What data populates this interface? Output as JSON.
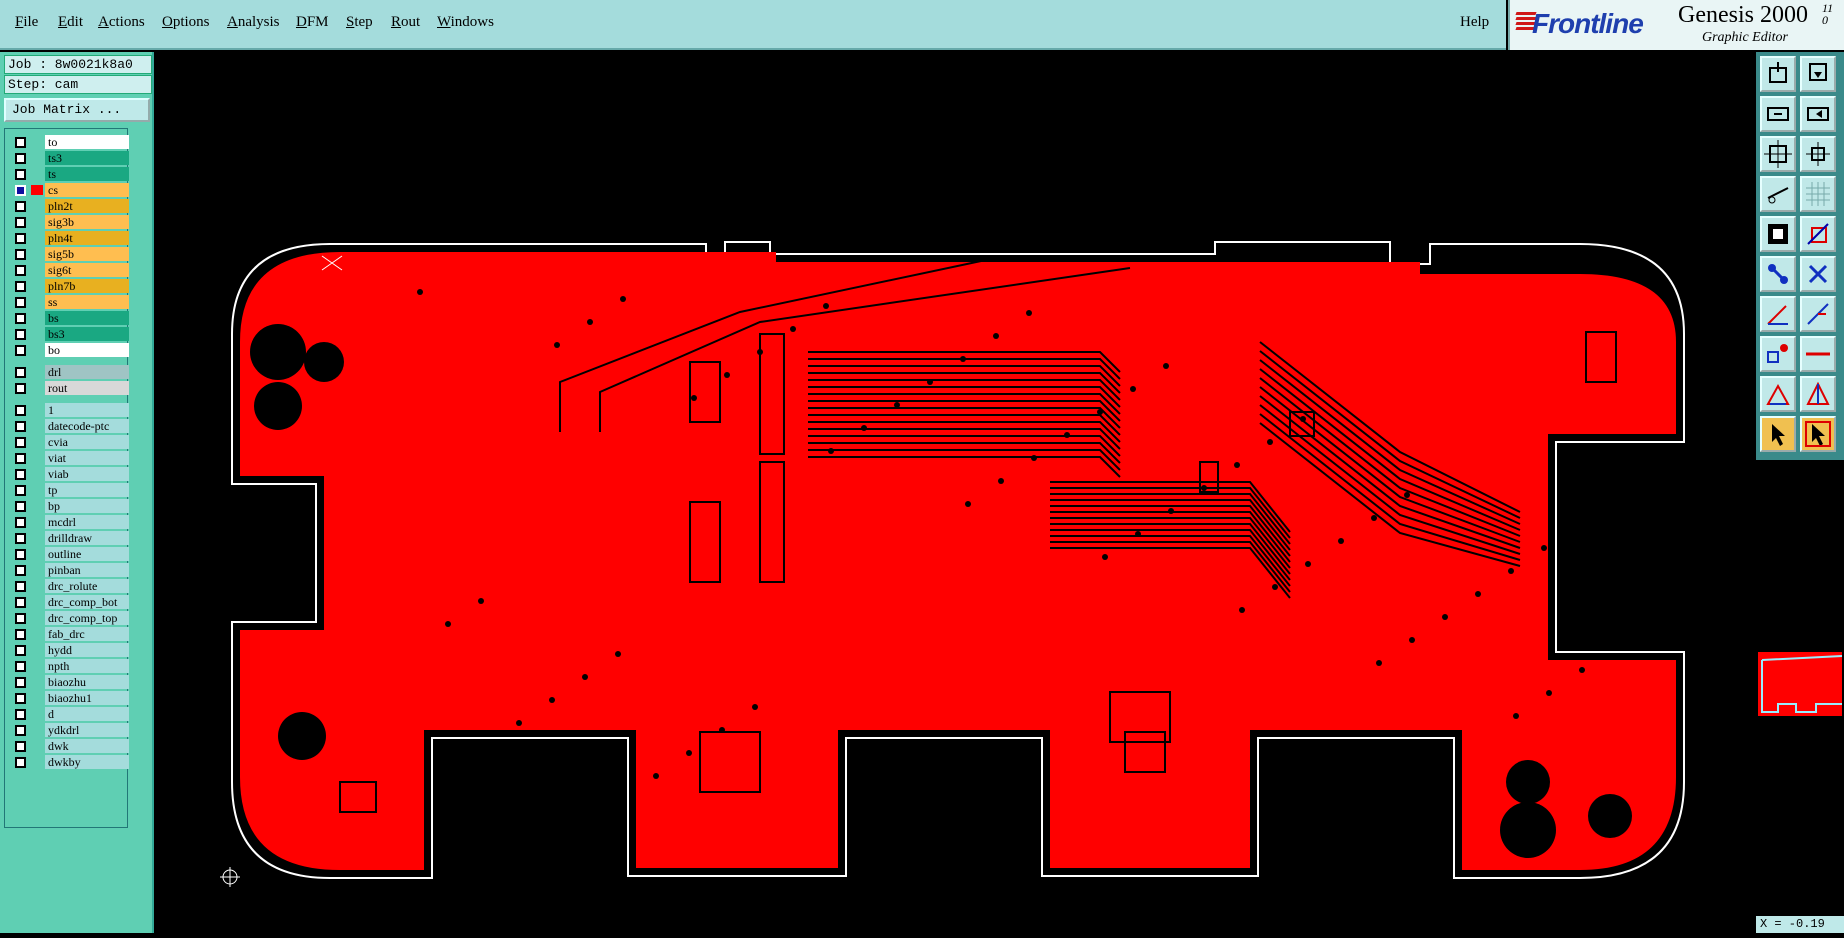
{
  "menubar": {
    "items": [
      "File",
      "Edit",
      "Actions",
      "Options",
      "Analysis",
      "DFM",
      "Step",
      "Rout",
      "Windows"
    ],
    "help": "Help"
  },
  "brand": {
    "logo": "Frontline",
    "product": "Genesis 2000",
    "version_top": "11",
    "version_bottom": "0",
    "subtitle": "Graphic Editor"
  },
  "job": {
    "job_label": "Job : 8w0021k8a0",
    "step_label": "Step: cam",
    "matrix_button": "Job Matrix ..."
  },
  "layers": [
    {
      "name": "to",
      "color": "#ffffff",
      "active": false
    },
    {
      "name": "ts3",
      "color": "#1aa882",
      "active": false
    },
    {
      "name": "ts",
      "color": "#1aa882",
      "active": false
    },
    {
      "name": "cs",
      "color": "#ffbe50",
      "active": true
    },
    {
      "name": "pln2t",
      "color": "#e8b020",
      "active": false
    },
    {
      "name": "sig3b",
      "color": "#ffbe50",
      "active": false
    },
    {
      "name": "pln4t",
      "color": "#e8b020",
      "active": false
    },
    {
      "name": "sig5b",
      "color": "#ffbe50",
      "active": false
    },
    {
      "name": "sig6t",
      "color": "#ffbe50",
      "active": false
    },
    {
      "name": "pln7b",
      "color": "#e8b020",
      "active": false
    },
    {
      "name": "ss",
      "color": "#ffbe50",
      "active": false
    },
    {
      "name": "bs",
      "color": "#1aa882",
      "active": false
    },
    {
      "name": "bs3",
      "color": "#1aa882",
      "active": false
    },
    {
      "name": "bo",
      "color": "#ffffff",
      "active": false
    },
    {
      "name": "drl",
      "color": "#9fc4c4",
      "active": false
    },
    {
      "name": "rout",
      "color": "#d8d8d8",
      "active": false
    },
    {
      "name": "1",
      "color": "#a4dcdc",
      "active": false
    },
    {
      "name": "datecode-ptc",
      "color": "#a4dcdc",
      "active": false
    },
    {
      "name": "cvia",
      "color": "#a4dcdc",
      "active": false
    },
    {
      "name": "viat",
      "color": "#a4dcdc",
      "active": false
    },
    {
      "name": "viab",
      "color": "#a4dcdc",
      "active": false
    },
    {
      "name": "tp",
      "color": "#a4dcdc",
      "active": false
    },
    {
      "name": "bp",
      "color": "#a4dcdc",
      "active": false
    },
    {
      "name": "mcdrl",
      "color": "#a4dcdc",
      "active": false
    },
    {
      "name": "drilldraw",
      "color": "#a4dcdc",
      "active": false
    },
    {
      "name": "outline",
      "color": "#a4dcdc",
      "active": false
    },
    {
      "name": "pinban",
      "color": "#a4dcdc",
      "active": false
    },
    {
      "name": "drc_rolute",
      "color": "#a4dcdc",
      "active": false
    },
    {
      "name": "drc_comp_bot",
      "color": "#a4dcdc",
      "active": false
    },
    {
      "name": "drc_comp_top",
      "color": "#a4dcdc",
      "active": false
    },
    {
      "name": "fab_drc",
      "color": "#a4dcdc",
      "active": false
    },
    {
      "name": "hydd",
      "color": "#a4dcdc",
      "active": false
    },
    {
      "name": "npth",
      "color": "#a4dcdc",
      "active": false
    },
    {
      "name": "biaozhu",
      "color": "#a4dcdc",
      "active": false
    },
    {
      "name": "biaozhu1",
      "color": "#a4dcdc",
      "active": false
    },
    {
      "name": "d",
      "color": "#a4dcdc",
      "active": false
    },
    {
      "name": "ydkdrl",
      "color": "#a4dcdc",
      "active": false
    },
    {
      "name": "dwk",
      "color": "#a4dcdc",
      "active": false
    },
    {
      "name": "dwkby",
      "color": "#a4dcdc",
      "active": false
    }
  ],
  "colors": {
    "copper": "#ff0000",
    "outline": "#ffffff",
    "menu_bg": "#a4dcdc",
    "sidebar_bg": "#5fcfb3"
  },
  "toolbar": {
    "icons": [
      "snapshot-icon",
      "save-icon",
      "zoom-home-icon",
      "zoom-back-icon",
      "fit-icon",
      "zoom-area-icon",
      "measure-icon",
      "grid-icon",
      "select-icon",
      "move-icon",
      "edit-icon",
      "delete-icon",
      "line-icon",
      "arc-icon",
      "net-icon",
      "line2-icon",
      "triangle-icon",
      "triangle2-icon",
      "pointer-icon",
      "pointer2-icon"
    ]
  },
  "status": {
    "coords": "X = -0.19"
  }
}
